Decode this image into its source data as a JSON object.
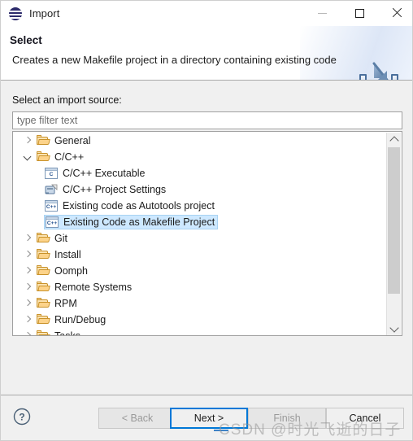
{
  "window": {
    "title": "Import",
    "app_icon": "eclipse-icon",
    "controls": {
      "minimize": "minimize-icon",
      "maximize": "maximize-icon",
      "close": "close-icon"
    }
  },
  "banner": {
    "heading": "Select",
    "description": "Creates a new Makefile project in a directory containing existing code",
    "icon": "import-arrow-icon"
  },
  "main": {
    "source_label": "Select an import source:",
    "filter": {
      "value": "",
      "placeholder": "type filter text"
    },
    "tree": [
      {
        "label": "General",
        "level": 0,
        "icon": "folder-icon",
        "twisty": "collapsed",
        "selected": false
      },
      {
        "label": "C/C++",
        "level": 0,
        "icon": "folder-icon",
        "twisty": "expanded",
        "selected": false
      },
      {
        "label": "C/C++ Executable",
        "level": 1,
        "icon": "c-file-icon",
        "twisty": "none",
        "selected": false
      },
      {
        "label": "C/C++ Project Settings",
        "level": 1,
        "icon": "settings-icon",
        "twisty": "none",
        "selected": false
      },
      {
        "label": "Existing code as Autotools project",
        "level": 1,
        "icon": "cpp-file-icon",
        "twisty": "none",
        "selected": false
      },
      {
        "label": "Existing Code as Makefile Project",
        "level": 1,
        "icon": "cpp-file-icon",
        "twisty": "none",
        "selected": true
      },
      {
        "label": "Git",
        "level": 0,
        "icon": "folder-icon",
        "twisty": "collapsed",
        "selected": false
      },
      {
        "label": "Install",
        "level": 0,
        "icon": "folder-icon",
        "twisty": "collapsed",
        "selected": false
      },
      {
        "label": "Oomph",
        "level": 0,
        "icon": "folder-icon",
        "twisty": "collapsed",
        "selected": false
      },
      {
        "label": "Remote Systems",
        "level": 0,
        "icon": "folder-icon",
        "twisty": "collapsed",
        "selected": false
      },
      {
        "label": "RPM",
        "level": 0,
        "icon": "folder-icon",
        "twisty": "collapsed",
        "selected": false
      },
      {
        "label": "Run/Debug",
        "level": 0,
        "icon": "folder-icon",
        "twisty": "collapsed",
        "selected": false
      },
      {
        "label": "Tasks",
        "level": 0,
        "icon": "folder-icon",
        "twisty": "collapsed",
        "selected": false
      }
    ],
    "icon_glyphs": {
      "c-file-icon": "C",
      "cpp-file-icon": "C++"
    },
    "scrollbar": {
      "up_arrow": "chevron-up-icon",
      "down_arrow": "chevron-down-icon"
    }
  },
  "footer": {
    "help_icon": "help-question-icon",
    "back_label": "< Back",
    "next_label": "Next >",
    "finish_label": "Finish",
    "cancel_label": "Cancel"
  },
  "watermark": {
    "text": "CSDN @时光飞逝的日子"
  },
  "colors": {
    "selection": "#cde8ff",
    "selection_border": "#a7d2f2",
    "focus_border": "#0078d7",
    "dialog_bg": "#f0f0f0",
    "folder": "#fcd38a"
  }
}
